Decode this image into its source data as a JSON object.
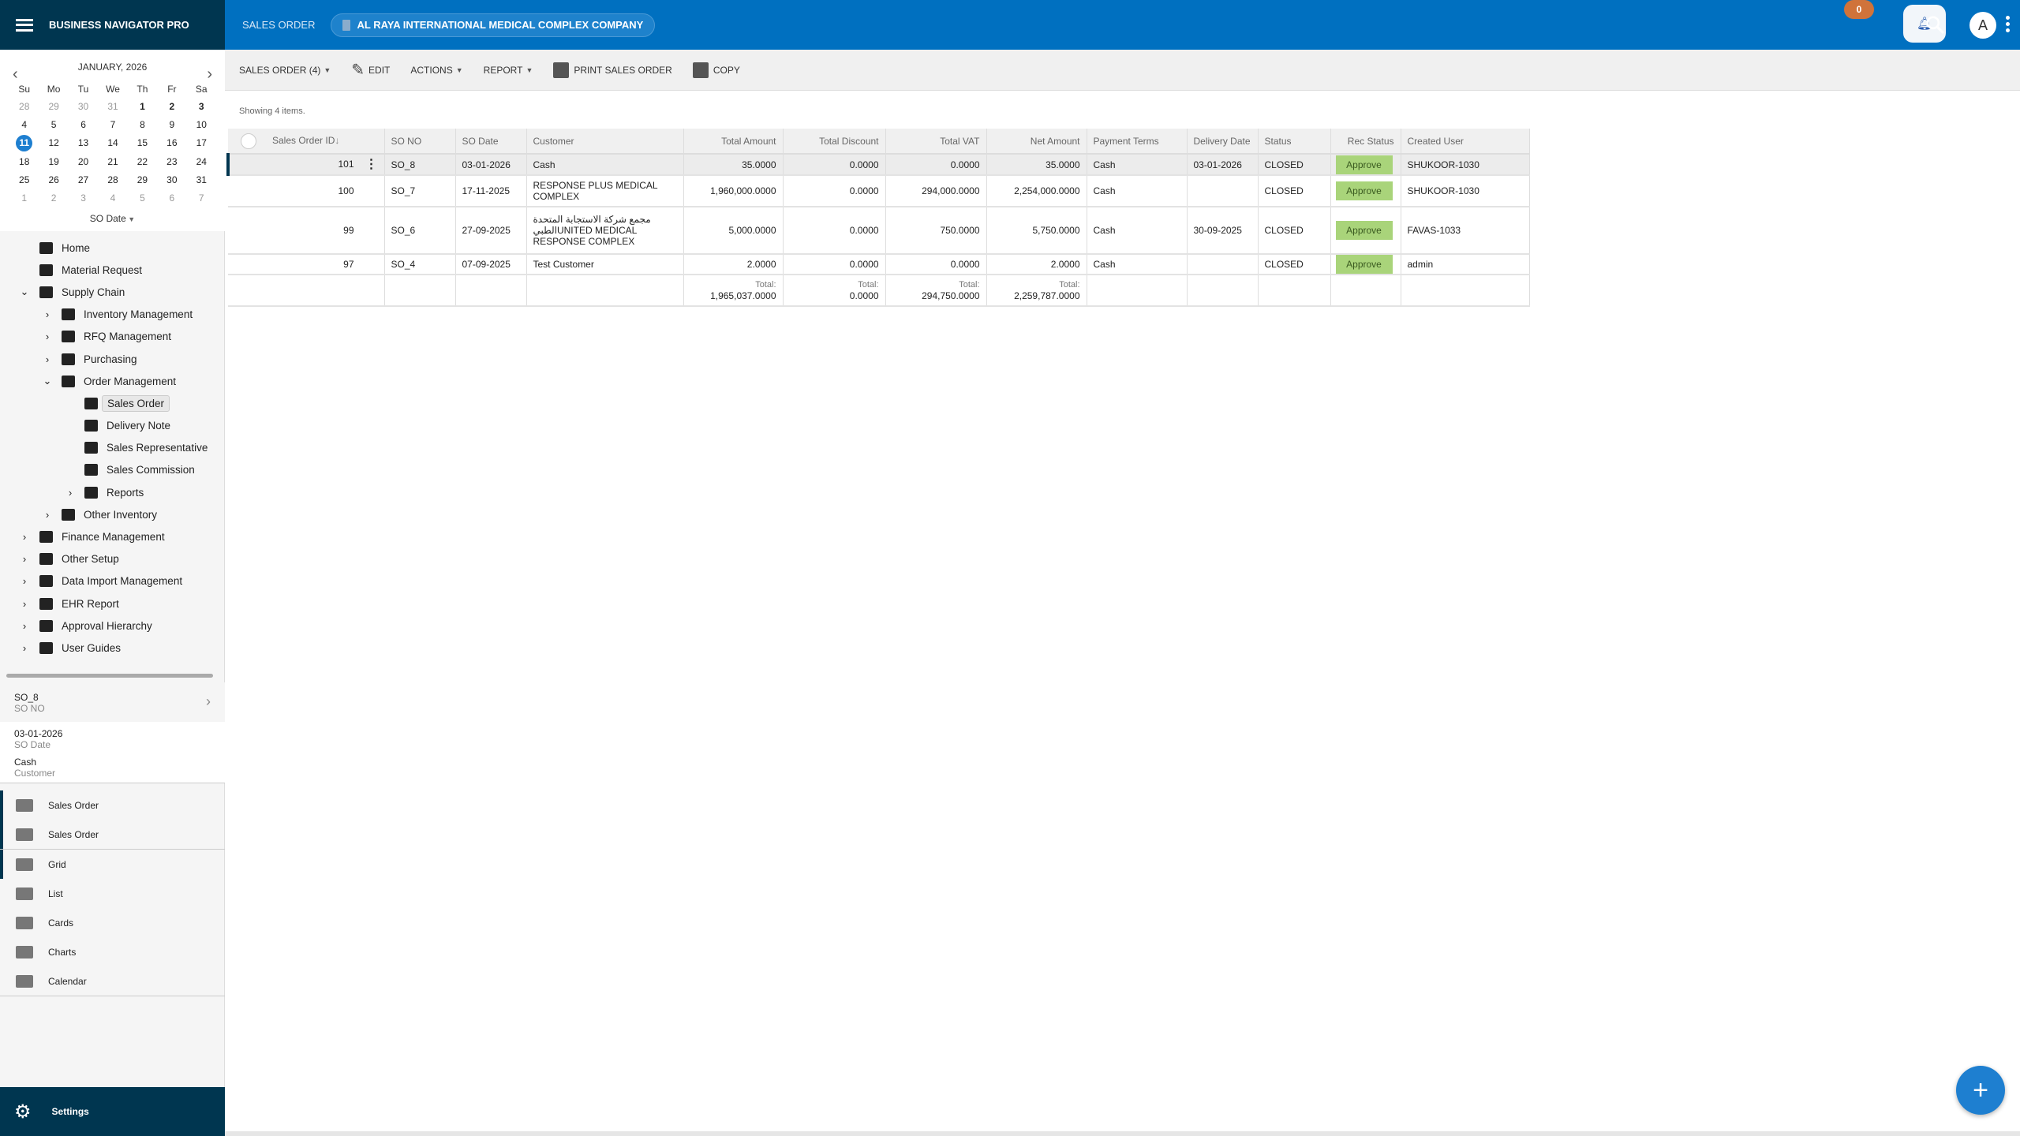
{
  "app": {
    "title": "BUSINESS NAVIGATOR PRO",
    "module": "SALES ORDER",
    "company": "AL RAYA INTERNATIONAL MEDICAL COMPLEX COMPANY",
    "notifications": "0",
    "avatar": "A"
  },
  "calendar": {
    "month": "JANUARY, 2026",
    "weekdays": [
      "Su",
      "Mo",
      "Tu",
      "We",
      "Th",
      "Fr",
      "Sa"
    ],
    "days": [
      [
        "28",
        "o"
      ],
      [
        "29",
        "o"
      ],
      [
        "30",
        "o"
      ],
      [
        "31",
        "o"
      ],
      [
        "1",
        "b"
      ],
      [
        "2",
        "b"
      ],
      [
        "3",
        "b"
      ],
      [
        "4",
        ""
      ],
      [
        "5",
        ""
      ],
      [
        "6",
        ""
      ],
      [
        "7",
        ""
      ],
      [
        "8",
        ""
      ],
      [
        "9",
        ""
      ],
      [
        "10",
        ""
      ],
      [
        "11",
        "sel"
      ],
      [
        "12",
        ""
      ],
      [
        "13",
        ""
      ],
      [
        "14",
        ""
      ],
      [
        "15",
        ""
      ],
      [
        "16",
        ""
      ],
      [
        "17",
        ""
      ],
      [
        "18",
        ""
      ],
      [
        "19",
        ""
      ],
      [
        "20",
        ""
      ],
      [
        "21",
        ""
      ],
      [
        "22",
        ""
      ],
      [
        "23",
        ""
      ],
      [
        "24",
        ""
      ],
      [
        "25",
        ""
      ],
      [
        "26",
        ""
      ],
      [
        "27",
        ""
      ],
      [
        "28",
        ""
      ],
      [
        "29",
        ""
      ],
      [
        "30",
        ""
      ],
      [
        "31",
        ""
      ],
      [
        "1",
        "o"
      ],
      [
        "2",
        "o"
      ],
      [
        "3",
        "o"
      ],
      [
        "4",
        "o"
      ],
      [
        "5",
        "o"
      ],
      [
        "6",
        "o"
      ],
      [
        "7",
        "o"
      ]
    ],
    "field": "SO Date"
  },
  "nav": [
    {
      "label": "Home",
      "level": 0,
      "chev": "",
      "icon": "home-icon"
    },
    {
      "label": "Material Request",
      "level": 0,
      "chev": "",
      "icon": "envelope-open-icon"
    },
    {
      "label": "Supply Chain",
      "level": 0,
      "chev": "down",
      "icon": "clipboard-check-icon"
    },
    {
      "label": "Inventory Management",
      "level": 1,
      "chev": "right",
      "icon": "archive-icon"
    },
    {
      "label": "RFQ Management",
      "level": 1,
      "chev": "right",
      "icon": "dots-grid-icon"
    },
    {
      "label": "Purchasing",
      "level": 1,
      "chev": "right",
      "icon": "cart-icon"
    },
    {
      "label": "Order Management",
      "level": 1,
      "chev": "down",
      "icon": "receipt-icon"
    },
    {
      "label": "Sales Order",
      "level": 2,
      "chev": "",
      "icon": "receipt-icon",
      "selected": true
    },
    {
      "label": "Delivery Note",
      "level": 2,
      "chev": "",
      "icon": "truck-icon"
    },
    {
      "label": "Sales Representative",
      "level": 2,
      "chev": "",
      "icon": "user-icon"
    },
    {
      "label": "Sales Commission",
      "level": 2,
      "chev": "",
      "icon": "calculator-icon"
    },
    {
      "label": "Reports",
      "level": 2,
      "chev": "right",
      "icon": "chart-icon",
      "sub": true
    },
    {
      "label": "Other Inventory",
      "level": 1,
      "chev": "right",
      "icon": "clipboard-check-icon"
    },
    {
      "label": "Finance Management",
      "level": 0,
      "chev": "right",
      "icon": "finance-icon"
    },
    {
      "label": "Other Setup",
      "level": 0,
      "chev": "right",
      "icon": "setup-icon"
    },
    {
      "label": "Data Import Management",
      "level": 0,
      "chev": "right",
      "icon": "upload-icon"
    },
    {
      "label": "EHR Report",
      "level": 0,
      "chev": "right",
      "icon": "gauge-icon"
    },
    {
      "label": "Approval Hierarchy",
      "level": 0,
      "chev": "right",
      "icon": "upload-icon"
    },
    {
      "label": "User Guides",
      "level": 0,
      "chev": "right",
      "icon": "help-icon"
    }
  ],
  "detail": {
    "so_no": "SO_8",
    "so_no_label": "SO NO",
    "so_date": "03-01-2026",
    "so_date_label": "SO Date",
    "customer": "Cash",
    "customer_label": "Customer"
  },
  "folders": [
    "Sales Order",
    "Sales Order"
  ],
  "views": [
    {
      "label": "Grid",
      "icon": "grid-icon"
    },
    {
      "label": "List",
      "icon": "list-icon"
    },
    {
      "label": "Cards",
      "icon": "cards-icon"
    },
    {
      "label": "Charts",
      "icon": "bar-chart-icon"
    },
    {
      "label": "Calendar",
      "icon": "calendar-icon"
    }
  ],
  "settings": "Settings",
  "toolbar": {
    "sales_order": "SALES ORDER (4)",
    "edit": "EDIT",
    "actions": "ACTIONS",
    "report": "REPORT",
    "print": "PRINT SALES ORDER",
    "copy": "COPY"
  },
  "showing": "Showing 4 items.",
  "table": {
    "columns": [
      "Sales Order ID",
      "SO NO",
      "SO Date",
      "Customer",
      "Total Amount",
      "Total Discount",
      "Total VAT",
      "Net Amount",
      "Payment Terms",
      "Delivery Date",
      "Status",
      "Rec Status",
      "Created User"
    ],
    "rows": [
      [
        "101",
        "SO_8",
        "03-01-2026",
        "Cash",
        "35.0000",
        "0.0000",
        "0.0000",
        "35.0000",
        "Cash",
        "03-01-2026",
        "CLOSED",
        "Approve",
        "SHUKOOR-1030"
      ],
      [
        "100",
        "SO_7",
        "17-11-2025",
        "RESPONSE PLUS MEDICAL COMPLEX",
        "1,960,000.0000",
        "0.0000",
        "294,000.0000",
        "2,254,000.0000",
        "Cash",
        "",
        "CLOSED",
        "Approve",
        "SHUKOOR-1030"
      ],
      [
        "99",
        "SO_6",
        "27-09-2025",
        "مجمع شركة الاستجابة المتحدة الطبيUNITED MEDICAL RESPONSE COMPLEX",
        "5,000.0000",
        "0.0000",
        "750.0000",
        "5,750.0000",
        "Cash",
        "30-09-2025",
        "CLOSED",
        "Approve",
        "FAVAS-1033"
      ],
      [
        "97",
        "SO_4",
        "07-09-2025",
        "Test Customer",
        "2.0000",
        "0.0000",
        "0.0000",
        "2.0000",
        "Cash",
        "",
        "CLOSED",
        "Approve",
        "admin"
      ]
    ],
    "total_label": "Total:",
    "totals": {
      "total_amount": "1,965,037.0000",
      "total_discount": "0.0000",
      "total_vat": "294,750.0000",
      "net_amount": "2,259,787.0000"
    }
  },
  "colors": {
    "brand": "#003650",
    "header": "#0070c0",
    "approve": "#a9d47a",
    "accent": "#1e7fd0",
    "badge": "#d0733a"
  }
}
